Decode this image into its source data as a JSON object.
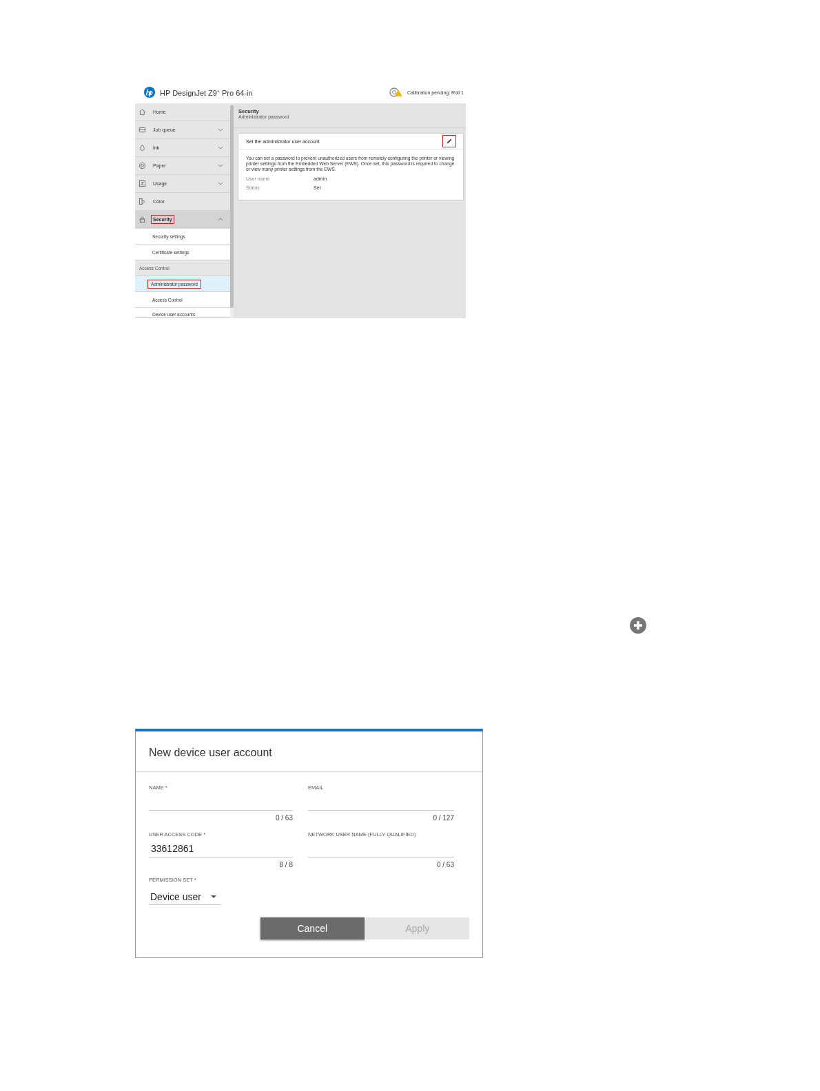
{
  "printer_ui": {
    "header": {
      "title": "HP DesignJet Z9⁺ Pro 64-in",
      "status": "Calibration pending: Roll 1"
    },
    "sidebar": {
      "items": [
        {
          "kind": "nav",
          "label": "Home",
          "selected": false,
          "highlighted": false
        },
        {
          "kind": "menu",
          "label": "Job queue",
          "expanded": false,
          "selected": false,
          "highlighted": false
        },
        {
          "kind": "menu",
          "label": "Ink",
          "expanded": false,
          "selected": false,
          "highlighted": false
        },
        {
          "kind": "menu",
          "label": "Paper",
          "expanded": false,
          "selected": false,
          "highlighted": false
        },
        {
          "kind": "menu",
          "label": "Usage",
          "expanded": false,
          "selected": false,
          "highlighted": false
        },
        {
          "kind": "nav",
          "label": "Color",
          "selected": false,
          "highlighted": false
        },
        {
          "kind": "menu",
          "label": "Security",
          "expanded": true,
          "selected": true,
          "highlighted": true
        },
        {
          "kind": "sub",
          "label": "Security settings",
          "selected": false,
          "highlighted": false
        },
        {
          "kind": "sub",
          "label": "Certificate settings",
          "selected": false,
          "highlighted": false
        },
        {
          "kind": "group",
          "label": "Access Control",
          "selected": false,
          "highlighted": false
        },
        {
          "kind": "sub",
          "label": "Administrator password",
          "selected": true,
          "highlighted": true
        },
        {
          "kind": "sub",
          "label": "Access Control",
          "selected": false,
          "highlighted": false
        },
        {
          "kind": "sub",
          "label": "Device user accounts",
          "selected": false,
          "highlighted": false
        }
      ]
    },
    "main": {
      "title": "Security",
      "subtitle": "Administrator password",
      "card": {
        "title": "Set the administrator user account",
        "edit_highlighted": true,
        "description": "You can set a password to prevent unauthorized users from remotely configuring the printer or viewing printer settings from the Embedded Web Server (EWS). Once set, this password is required to change or view many printer settings from the EWS.",
        "fields": [
          {
            "label": "User name",
            "value": "admin"
          },
          {
            "label": "Status",
            "value": "Set"
          }
        ]
      }
    }
  },
  "dialog": {
    "title": "New device user account",
    "fields": [
      {
        "label": "NAME *",
        "counter": "0 / 63"
      },
      {
        "label": "EMAIL",
        "counter": "0 / 127"
      },
      {
        "label": "USER ACCESS CODE *",
        "value": "33612861",
        "counter": "8 / 8"
      },
      {
        "label": "NETWORK USER NAME (FULLY QUALIFIED)",
        "counter": "0 / 63"
      }
    ],
    "permission_set": {
      "label": "PERMISSION SET *",
      "value": "Device user"
    },
    "buttons": [
      {
        "label": "Cancel",
        "disabled": false
      },
      {
        "label": "Apply",
        "disabled": true
      }
    ]
  }
}
